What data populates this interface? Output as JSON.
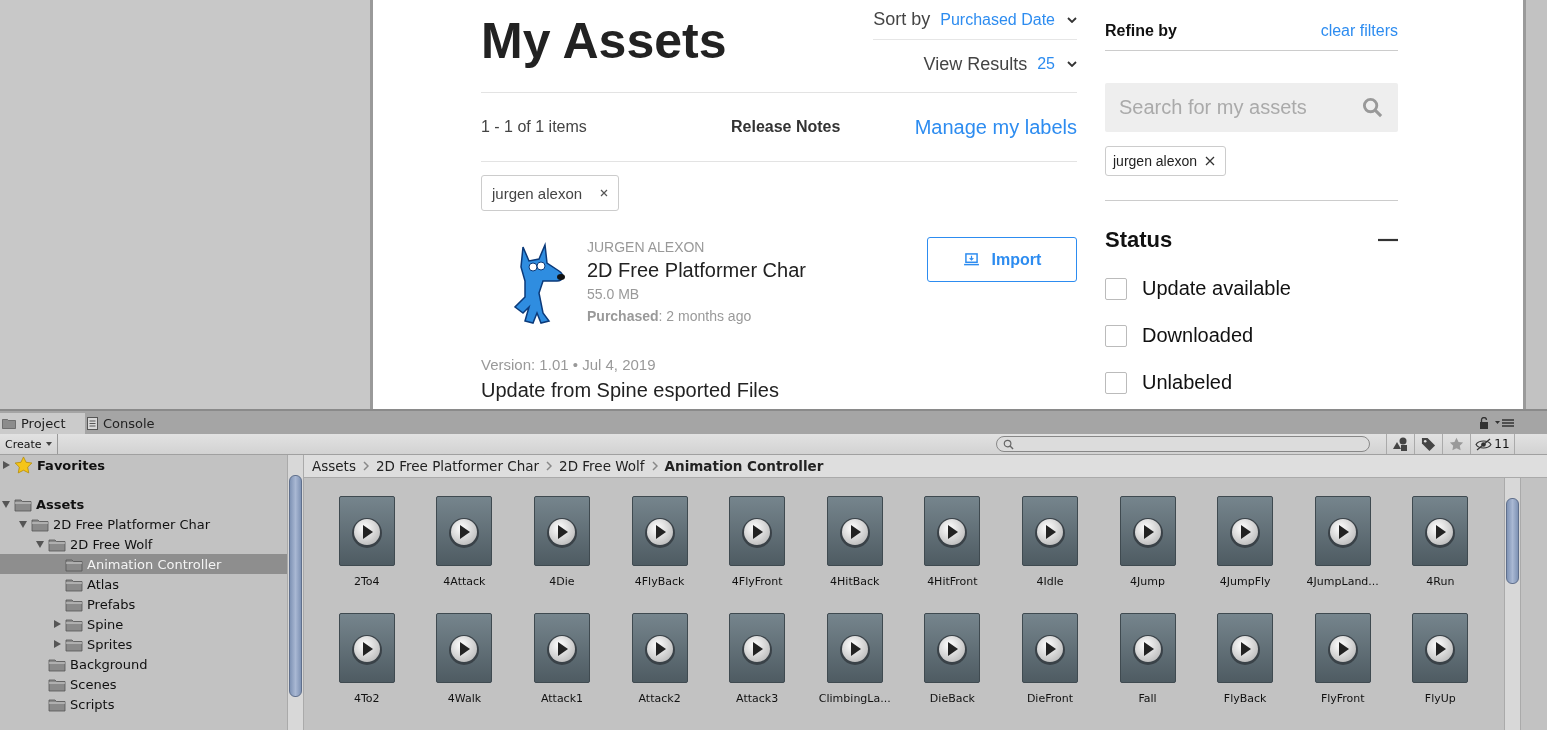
{
  "store": {
    "title": "My Assets",
    "sort": {
      "label": "Sort by",
      "value": "Purchased Date"
    },
    "view_results": {
      "label": "View Results",
      "value": "25"
    },
    "results_count": "1 - 1 of 1 items",
    "release_notes": "Release Notes",
    "manage_labels": "Manage my labels",
    "active_filters": [
      {
        "label": "jurgen alexon"
      }
    ],
    "assets": [
      {
        "publisher": "JURGEN ALEXON",
        "name": "2D Free Platformer Char",
        "size": "55.0 MB",
        "purchased": "**Purchased**: 2 months ago",
        "action": "Import",
        "version": "Version: 1.01 • Jul 4, 2019",
        "notes": "Update from Spine esported Files"
      }
    ]
  },
  "sidebar": {
    "title": "Refine by",
    "clear": "clear filters",
    "search_placeholder": "Search for my assets",
    "chips": [
      {
        "label": "jurgen alexon"
      }
    ],
    "status": {
      "title": "Status",
      "expanded": true,
      "options": [
        {
          "label": "Update available",
          "checked": false
        },
        {
          "label": "Downloaded",
          "checked": false
        },
        {
          "label": "Unlabeled",
          "checked": false
        }
      ]
    }
  },
  "editor": {
    "tabs": [
      {
        "label": "Project",
        "kind": "project",
        "selected": true
      },
      {
        "label": "Console",
        "kind": "console",
        "selected": false
      }
    ],
    "create_button": "Create",
    "hidden_count": "11",
    "tree": [
      {
        "label": "Favorites",
        "kind": "favorites",
        "expanded": false,
        "selected": false
      },
      {
        "label": "Assets",
        "kind": "root",
        "expanded": true,
        "selected": false,
        "children": [
          {
            "label": "2D Free Platformer Char",
            "kind": "folder",
            "expanded": true,
            "selected": false,
            "children": [
              {
                "label": "2D Free Wolf",
                "kind": "folder",
                "expanded": true,
                "selected": false,
                "children": [
                  {
                    "label": "Animation Controller",
                    "kind": "folder",
                    "selected": true
                  },
                  {
                    "label": "Atlas",
                    "kind": "folder",
                    "selected": false
                  },
                  {
                    "label": "Prefabs",
                    "kind": "folder",
                    "selected": false
                  },
                  {
                    "label": "Spine",
                    "kind": "folder",
                    "expanded": false,
                    "selected": false
                  },
                  {
                    "label": "Sprites",
                    "kind": "folder",
                    "expanded": false,
                    "selected": false
                  }
                ]
              },
              {
                "label": "Background",
                "kind": "folder",
                "selected": false
              },
              {
                "label": "Scenes",
                "kind": "folder",
                "selected": false
              },
              {
                "label": "Scripts",
                "kind": "folder",
                "selected": false
              }
            ]
          }
        ]
      }
    ],
    "breadcrumb": [
      "Assets",
      "2D Free Platformer Char",
      "2D Free Wolf",
      "Animation Controller"
    ],
    "clips": [
      "2To4",
      "4Attack",
      "4Die",
      "4FlyBack",
      "4FlyFront",
      "4HitBack",
      "4HitFront",
      "4Idle",
      "4Jump",
      "4JumpFly",
      "4JumpLand...",
      "4Run",
      "4To2",
      "4Walk",
      "Attack1",
      "Attack2",
      "Attack3",
      "ClimbingLa...",
      "DieBack",
      "DieFront",
      "Fall",
      "FlyBack",
      "FlyFront",
      "FlyUp"
    ]
  }
}
